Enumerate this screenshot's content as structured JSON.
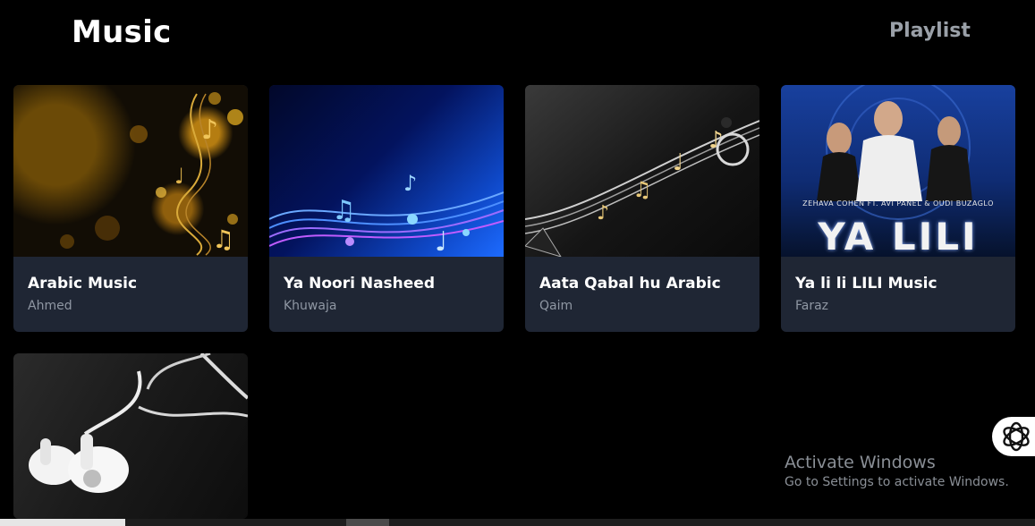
{
  "header": {
    "logo": "Music",
    "nav_playlist": "Playlist"
  },
  "cards": [
    {
      "title": "Arabic Music",
      "artist": "Ahmed"
    },
    {
      "title": "Ya Noori Nasheed",
      "artist": "Khuwaja"
    },
    {
      "title": "Aata Qabal hu Arabic",
      "artist": "Qaim"
    },
    {
      "title": "Ya li li LILI Music",
      "artist": "Faraz",
      "thumb_caption": "ZEHAVA COHEN FT. AVI PANEL & OUDI BUZAGLO",
      "thumb_logo": "YA LILI"
    },
    {
      "title": "",
      "artist": ""
    }
  ],
  "watermark": {
    "title": "Activate Windows",
    "subtitle": "Go to Settings to activate Windows."
  },
  "icons": {
    "floating_button": "openai-logo-icon"
  },
  "colors": {
    "card_bg": "#1f2634",
    "page_bg": "#000000",
    "nav_text": "#9aa0a8",
    "artist_text": "#8f97a3"
  }
}
